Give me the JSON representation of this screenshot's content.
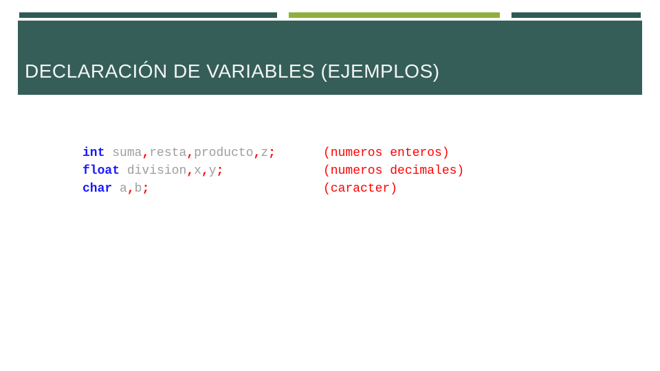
{
  "header": {
    "title": "DECLARACIÓN DE VARIABLES (EJEMPLOS)"
  },
  "code": {
    "lines": [
      {
        "keyword": "int",
        "identifiers": "suma",
        "rest_ids": [
          "resta",
          "producto",
          "z"
        ],
        "comment": "(numeros enteros)"
      },
      {
        "keyword": "float",
        "identifiers": "division",
        "rest_ids": [
          "x",
          "y"
        ],
        "comment": "(numeros decimales)"
      },
      {
        "keyword": "char",
        "identifiers": "a",
        "rest_ids": [
          "b"
        ],
        "comment": "(caracter)"
      }
    ],
    "punct": {
      "comma": ",",
      "semicolon": ";"
    }
  },
  "ruler": {
    "segments": [
      {
        "kind": "dark",
        "flex": 44
      },
      {
        "kind": "gap",
        "flex": 2
      },
      {
        "kind": "green",
        "flex": 36
      },
      {
        "kind": "gap",
        "flex": 2
      },
      {
        "kind": "dark",
        "flex": 22
      }
    ]
  }
}
